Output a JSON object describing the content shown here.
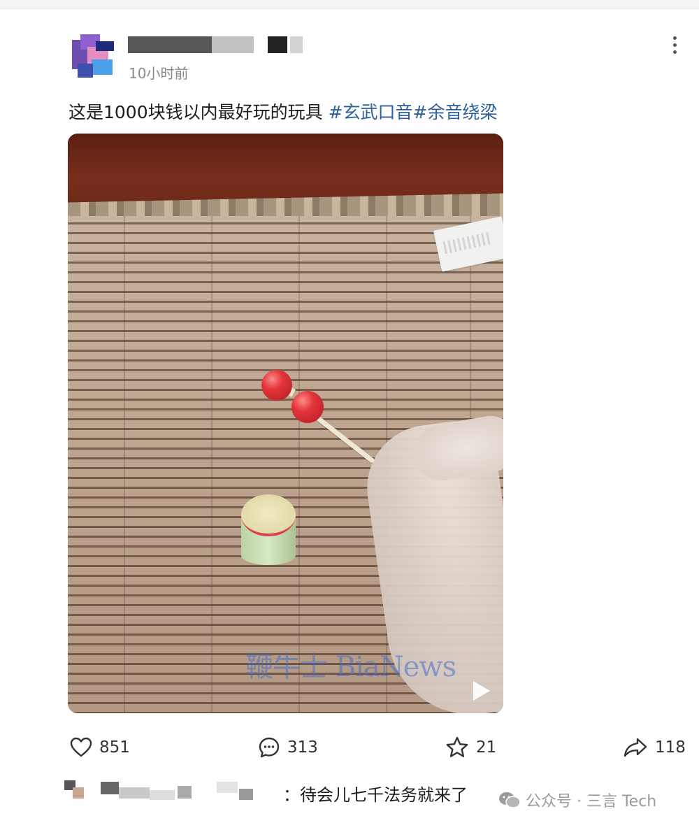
{
  "post": {
    "time": "10小时前",
    "caption": "这是1000块钱以内最好玩的玩具 ",
    "tags": [
      "#玄武口音",
      "#余音绕梁"
    ]
  },
  "media": {
    "watermark": "鞭牛士 BiaNews"
  },
  "actions": {
    "like_count": "851",
    "comment_count": "313",
    "favorite_count": "21",
    "share_count": "118"
  },
  "comment": {
    "text": "：待会儿七千法务就来了"
  },
  "footer_watermark": "公众号 · 三言 Tech",
  "icons": [
    "more-vertical-icon",
    "play-icon",
    "heart-icon",
    "comment-icon",
    "star-icon",
    "share-icon",
    "wechat-icon"
  ]
}
